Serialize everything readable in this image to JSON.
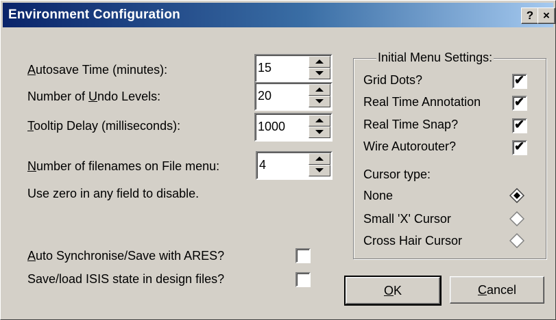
{
  "window": {
    "title": "Environment Configuration",
    "help_label": "?",
    "close_label": "×"
  },
  "fields": {
    "autosave": {
      "label_prefix": "",
      "mnemonic": "A",
      "label_rest": "utosave Time (minutes):",
      "value": "15"
    },
    "undo": {
      "label_prefix": "Number of ",
      "mnemonic": "U",
      "label_rest": "ndo Levels:",
      "value": "20"
    },
    "tooltip": {
      "label_prefix": "",
      "mnemonic": "T",
      "label_rest": "ooltip Delay (milliseconds):",
      "value": "1000"
    },
    "filenames": {
      "label_prefix": "",
      "mnemonic": "N",
      "label_rest": "umber of filenames on File menu:",
      "value": "4"
    },
    "hint": "Use zero in any field to disable."
  },
  "options": {
    "auto_sync": {
      "mnemonic": "A",
      "label_rest": "uto Synchronise/Save with ARES?",
      "checked": false
    },
    "save_state": {
      "label": "Save/load ISIS state in design files?",
      "checked": false
    }
  },
  "menu_settings": {
    "title": "Initial Menu Settings:",
    "checkboxes": [
      {
        "label": "Grid Dots?",
        "checked": true
      },
      {
        "label": "Real Time Annotation",
        "checked": true
      },
      {
        "label": "Real Time Snap?",
        "checked": true
      },
      {
        "label": "Wire Autorouter?",
        "checked": true
      }
    ],
    "cursor_label": "Cursor type:",
    "cursor_options": [
      {
        "label": "None",
        "selected": true
      },
      {
        "label": "Small 'X' Cursor",
        "selected": false
      },
      {
        "label": "Cross Hair Cursor",
        "selected": false
      }
    ]
  },
  "buttons": {
    "ok": {
      "mnemonic": "O",
      "label_rest": "K"
    },
    "cancel": {
      "mnemonic": "C",
      "label_rest": "ancel"
    }
  },
  "check_glyph": "✔"
}
